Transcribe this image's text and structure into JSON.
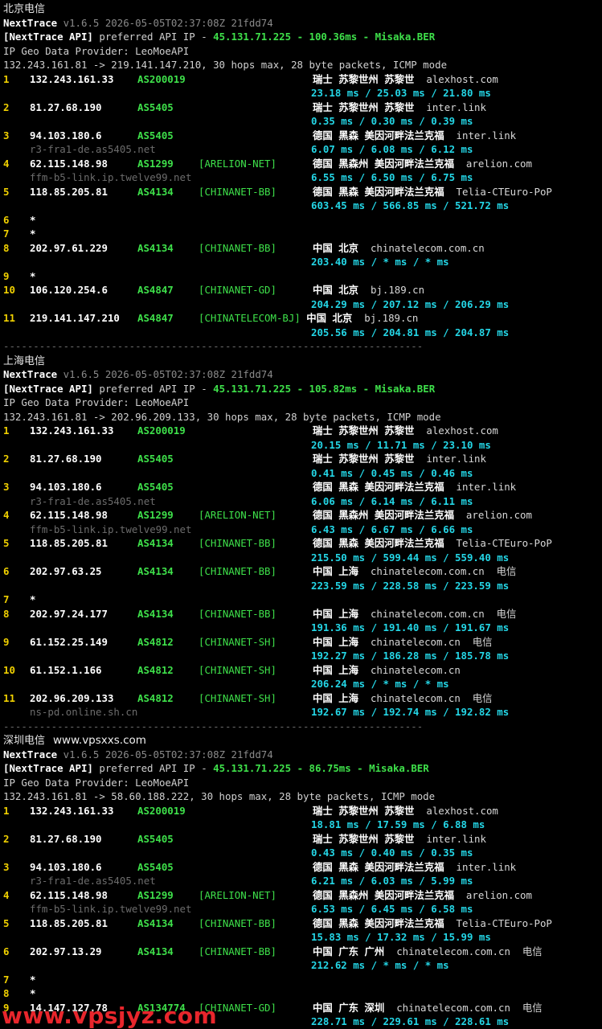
{
  "watermark": "www.vpsjyz.com",
  "sections": [
    {
      "title": "北京电信",
      "site_tag": "",
      "nexttrace": "NextTrace",
      "version_line": "v1.6.5 2026-05-05T02:37:08Z 21fdd74",
      "api_tag": "[NextTrace API]",
      "api_text": "preferred API IP - ",
      "api_ip": "45.131.71.225",
      "api_sep1": " - ",
      "api_ms": "100.36ms",
      "api_sep2": " - ",
      "api_node": "Misaka.BER",
      "geo_provider": "IP Geo Data Provider: LeoMoeAPI",
      "trace_line": "132.243.161.81 -> 219.141.147.210, 30 hops max, 28 byte packets, ICMP mode",
      "hops": [
        {
          "n": "1",
          "ip": "132.243.161.33",
          "as": "AS200019",
          "net": "",
          "geo": "瑞士 苏黎世州 苏黎世",
          "dom": "alexhost.com",
          "isp": "",
          "rtt": "23.18 ms / 25.03 ms / 21.80 ms",
          "rdns": ""
        },
        {
          "n": "2",
          "ip": "81.27.68.190",
          "as": "AS5405",
          "net": "",
          "geo": "瑞士 苏黎世州 苏黎世",
          "dom": "inter.link",
          "isp": "",
          "rtt": "0.35 ms / 0.30 ms / 0.39 ms",
          "rdns": ""
        },
        {
          "n": "3",
          "ip": "94.103.180.6",
          "as": "AS5405",
          "net": "",
          "geo": "德国 黑森 美因河畔法兰克福",
          "dom": "inter.link",
          "isp": "",
          "rtt": "6.07 ms / 6.08 ms / 6.12 ms",
          "rdns": "r3-fra1-de.as5405.net"
        },
        {
          "n": "4",
          "ip": "62.115.148.98",
          "as": "AS1299",
          "net": "[ARELION-NET]",
          "geo": "德国 黑森州 美因河畔法兰克福",
          "dom": "arelion.com",
          "isp": "",
          "rtt": "6.55 ms / 6.50 ms / 6.75 ms",
          "rdns": "ffm-b5-link.ip.twelve99.net"
        },
        {
          "n": "5",
          "ip": "118.85.205.81",
          "as": "AS4134",
          "net": "[CHINANET-BB]",
          "geo": "德国 黑森 美因河畔法兰克福",
          "dom": "Telia-CTEuro-PoP",
          "isp": "",
          "rtt": "603.45 ms / 566.85 ms / 521.72 ms",
          "rdns": ""
        },
        {
          "n": "6",
          "ip": "*",
          "as": "",
          "net": "",
          "geo": "",
          "dom": "",
          "isp": "",
          "rtt": "",
          "rdns": ""
        },
        {
          "n": "7",
          "ip": "*",
          "as": "",
          "net": "",
          "geo": "",
          "dom": "",
          "isp": "",
          "rtt": "",
          "rdns": ""
        },
        {
          "n": "8",
          "ip": "202.97.61.229",
          "as": "AS4134",
          "net": "[CHINANET-BB]",
          "geo": "中国 北京",
          "dom": "chinatelecom.com.cn",
          "isp": "",
          "rtt": "203.40 ms / * ms / * ms",
          "rdns": ""
        },
        {
          "n": "9",
          "ip": "*",
          "as": "",
          "net": "",
          "geo": "",
          "dom": "",
          "isp": "",
          "rtt": "",
          "rdns": ""
        },
        {
          "n": "10",
          "ip": "106.120.254.6",
          "as": "AS4847",
          "net": "[CHINANET-GD]",
          "geo": "中国 北京",
          "dom": "bj.189.cn",
          "isp": "",
          "rtt": "204.29 ms / 207.12 ms / 206.29 ms",
          "rdns": ""
        },
        {
          "n": "11",
          "ip": "219.141.147.210",
          "as": "AS4847",
          "net": "[CHINATELECOM-BJ]",
          "geo": "中国 北京",
          "dom": "bj.189.cn",
          "isp": "",
          "rtt": "205.56 ms / 204.81 ms / 204.87 ms",
          "rdns": ""
        }
      ]
    },
    {
      "title": "上海电信",
      "site_tag": "",
      "nexttrace": "NextTrace",
      "version_line": "v1.6.5 2026-05-05T02:37:08Z 21fdd74",
      "api_tag": "[NextTrace API]",
      "api_text": "preferred API IP - ",
      "api_ip": "45.131.71.225",
      "api_sep1": " - ",
      "api_ms": "105.82ms",
      "api_sep2": " - ",
      "api_node": "Misaka.BER",
      "geo_provider": "IP Geo Data Provider: LeoMoeAPI",
      "trace_line": "132.243.161.81 -> 202.96.209.133, 30 hops max, 28 byte packets, ICMP mode",
      "hops": [
        {
          "n": "1",
          "ip": "132.243.161.33",
          "as": "AS200019",
          "net": "",
          "geo": "瑞士 苏黎世州 苏黎世",
          "dom": "alexhost.com",
          "isp": "",
          "rtt": "20.15 ms / 11.71 ms / 23.10 ms",
          "rdns": ""
        },
        {
          "n": "2",
          "ip": "81.27.68.190",
          "as": "AS5405",
          "net": "",
          "geo": "瑞士 苏黎世州 苏黎世",
          "dom": "inter.link",
          "isp": "",
          "rtt": "0.41 ms / 0.45 ms / 0.46 ms",
          "rdns": ""
        },
        {
          "n": "3",
          "ip": "94.103.180.6",
          "as": "AS5405",
          "net": "",
          "geo": "德国 黑森 美因河畔法兰克福",
          "dom": "inter.link",
          "isp": "",
          "rtt": "6.06 ms / 6.14 ms / 6.11 ms",
          "rdns": "r3-fra1-de.as5405.net"
        },
        {
          "n": "4",
          "ip": "62.115.148.98",
          "as": "AS1299",
          "net": "[ARELION-NET]",
          "geo": "德国 黑森州 美因河畔法兰克福",
          "dom": "arelion.com",
          "isp": "",
          "rtt": "6.43 ms / 6.67 ms / 6.66 ms",
          "rdns": "ffm-b5-link.ip.twelve99.net"
        },
        {
          "n": "5",
          "ip": "118.85.205.81",
          "as": "AS4134",
          "net": "[CHINANET-BB]",
          "geo": "德国 黑森 美因河畔法兰克福",
          "dom": "Telia-CTEuro-PoP",
          "isp": "",
          "rtt": "215.50 ms / 599.44 ms / 559.40 ms",
          "rdns": ""
        },
        {
          "n": "6",
          "ip": "202.97.63.25",
          "as": "AS4134",
          "net": "[CHINANET-BB]",
          "geo": "中国 上海",
          "dom": "chinatelecom.com.cn",
          "isp": "电信",
          "rtt": "223.59 ms / 228.58 ms / 223.59 ms",
          "rdns": ""
        },
        {
          "n": "7",
          "ip": "*",
          "as": "",
          "net": "",
          "geo": "",
          "dom": "",
          "isp": "",
          "rtt": "",
          "rdns": ""
        },
        {
          "n": "8",
          "ip": "202.97.24.177",
          "as": "AS4134",
          "net": "[CHINANET-BB]",
          "geo": "中国 上海",
          "dom": "chinatelecom.com.cn",
          "isp": "电信",
          "rtt": "191.36 ms / 191.40 ms / 191.67 ms",
          "rdns": ""
        },
        {
          "n": "9",
          "ip": "61.152.25.149",
          "as": "AS4812",
          "net": "[CHINANET-SH]",
          "geo": "中国 上海",
          "dom": "chinatelecom.cn",
          "isp": "电信",
          "rtt": "192.27 ms / 186.28 ms / 185.78 ms",
          "rdns": ""
        },
        {
          "n": "10",
          "ip": "61.152.1.166",
          "as": "AS4812",
          "net": "[CHINANET-SH]",
          "geo": "中国 上海",
          "dom": "chinatelecom.cn",
          "isp": "",
          "rtt": "206.24 ms / * ms / * ms",
          "rdns": ""
        },
        {
          "n": "11",
          "ip": "202.96.209.133",
          "as": "AS4812",
          "net": "[CHINANET-SH]",
          "geo": "中国 上海",
          "dom": "chinatelecom.cn",
          "isp": "电信",
          "rtt": "192.67 ms / 192.74 ms / 192.82 ms",
          "rdns": "ns-pd.online.sh.cn"
        }
      ]
    },
    {
      "title": "深圳电信",
      "site_tag": "www.vpsxxs.com",
      "nexttrace": "NextTrace",
      "version_line": "v1.6.5 2026-05-05T02:37:08Z 21fdd74",
      "api_tag": "[NextTrace API]",
      "api_text": "preferred API IP - ",
      "api_ip": "45.131.71.225",
      "api_sep1": " - ",
      "api_ms": "86.75ms",
      "api_sep2": " - ",
      "api_node": "Misaka.BER",
      "geo_provider": "IP Geo Data Provider: LeoMoeAPI",
      "trace_line": "132.243.161.81 -> 58.60.188.222, 30 hops max, 28 byte packets, ICMP mode",
      "hops": [
        {
          "n": "1",
          "ip": "132.243.161.33",
          "as": "AS200019",
          "net": "",
          "geo": "瑞士 苏黎世州 苏黎世",
          "dom": "alexhost.com",
          "isp": "",
          "rtt": "18.81 ms / 17.59 ms / 6.88 ms",
          "rdns": ""
        },
        {
          "n": "2",
          "ip": "81.27.68.190",
          "as": "AS5405",
          "net": "",
          "geo": "瑞士 苏黎世州 苏黎世",
          "dom": "inter.link",
          "isp": "",
          "rtt": "0.43 ms / 0.40 ms / 0.35 ms",
          "rdns": ""
        },
        {
          "n": "3",
          "ip": "94.103.180.6",
          "as": "AS5405",
          "net": "",
          "geo": "德国 黑森 美因河畔法兰克福",
          "dom": "inter.link",
          "isp": "",
          "rtt": "6.21 ms / 6.03 ms / 5.99 ms",
          "rdns": "r3-fra1-de.as5405.net"
        },
        {
          "n": "4",
          "ip": "62.115.148.98",
          "as": "AS1299",
          "net": "[ARELION-NET]",
          "geo": "德国 黑森州 美因河畔法兰克福",
          "dom": "arelion.com",
          "isp": "",
          "rtt": "6.53 ms / 6.45 ms / 6.58 ms",
          "rdns": "ffm-b5-link.ip.twelve99.net"
        },
        {
          "n": "5",
          "ip": "118.85.205.81",
          "as": "AS4134",
          "net": "[CHINANET-BB]",
          "geo": "德国 黑森 美因河畔法兰克福",
          "dom": "Telia-CTEuro-PoP",
          "isp": "",
          "rtt": "15.83 ms / 17.32 ms / 15.99 ms",
          "rdns": ""
        },
        {
          "n": "6",
          "ip": "202.97.13.29",
          "as": "AS4134",
          "net": "[CHINANET-BB]",
          "geo": "中国 广东 广州",
          "dom": "chinatelecom.com.cn",
          "isp": "电信",
          "rtt": "212.62 ms / * ms / * ms",
          "rdns": ""
        },
        {
          "n": "7",
          "ip": "*",
          "as": "",
          "net": "",
          "geo": "",
          "dom": "",
          "isp": "",
          "rtt": "",
          "rdns": ""
        },
        {
          "n": "8",
          "ip": "*",
          "as": "",
          "net": "",
          "geo": "",
          "dom": "",
          "isp": "",
          "rtt": "",
          "rdns": ""
        },
        {
          "n": "9",
          "ip": "14.147.127.78",
          "as": "AS134774",
          "net": "[CHINANET-GD]",
          "geo": "中国 广东 深圳",
          "dom": "chinatelecom.com.cn",
          "isp": "电信",
          "rtt": "228.71 ms / 229.61 ms / 228.61 ms",
          "rdns": ""
        }
      ]
    }
  ]
}
